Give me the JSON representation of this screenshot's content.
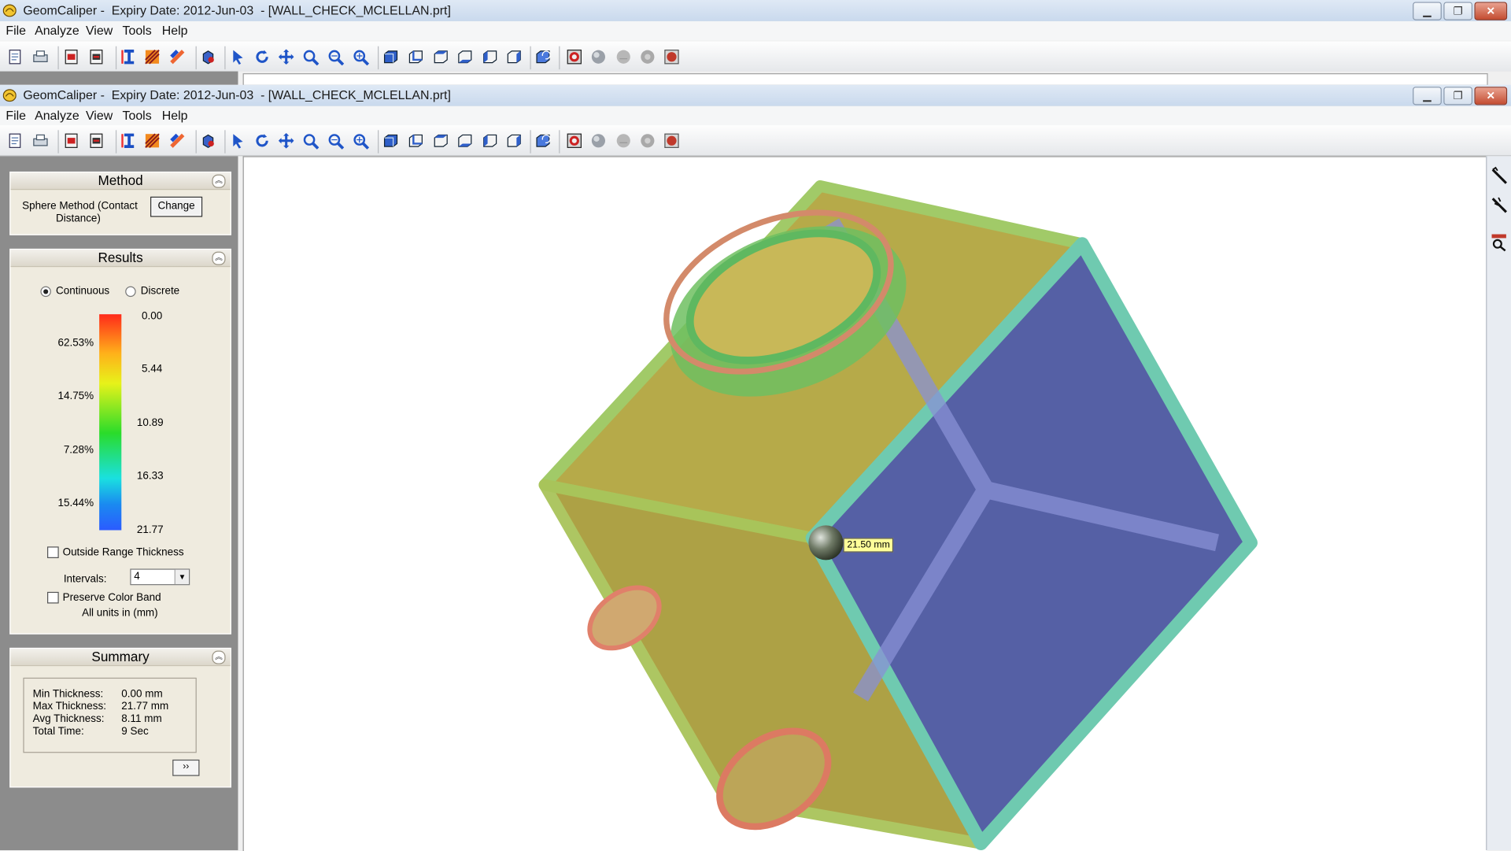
{
  "window": {
    "title": "GeomCaliper -  Expiry Date: 2012-Jun-03  - [WALL_CHECK_MCLELLAN.prt]",
    "buttons": {
      "minimize": "▁",
      "restore": "❐",
      "close": "✕"
    }
  },
  "menu": [
    "File",
    "Analyze",
    "View",
    "Tools",
    "Help"
  ],
  "toolbar": {
    "icons": [
      "new-icon",
      "print-icon",
      "import-icon",
      "export-icon",
      "wall-thickness-icon",
      "analysis-icon",
      "surface-icon",
      "part-icon",
      "select-arrow-icon",
      "rotate-icon",
      "pan-icon",
      "zoom-window-icon",
      "zoom-icon",
      "zoom-fit-icon",
      "view-front-icon",
      "view-back-icon",
      "view-top-icon",
      "view-bottom-icon",
      "view-left-icon",
      "view-right-icon",
      "view-iso-icon",
      "section-icon",
      "sphere-icon",
      "probe-icon",
      "sphere-gray-icon",
      "clear-icon"
    ]
  },
  "method": {
    "header": "Method",
    "text_line1": "Sphere Method (Contact",
    "text_line2": "Distance)",
    "change_label": "Change"
  },
  "results": {
    "header": "Results",
    "continuous_label": "Continuous",
    "discrete_label": "Discrete",
    "scale_values": [
      "0.00",
      "5.44",
      "10.89",
      "16.33",
      "21.77"
    ],
    "percentages": [
      "62.53%",
      "14.75%",
      "7.28%",
      "15.44%"
    ],
    "outside_range_label": "Outside Range Thickness",
    "intervals_label": "Intervals:",
    "intervals_value": "4",
    "preserve_label": "Preserve Color Band",
    "units_note": "All units in (mm)"
  },
  "summary": {
    "header": "Summary",
    "rows": [
      {
        "label": "Min Thickness:",
        "value": "0.00 mm"
      },
      {
        "label": "Max Thickness:",
        "value": "21.77 mm"
      },
      {
        "label": "Avg Thickness:",
        "value": "8.11 mm"
      },
      {
        "label": "Total Time:",
        "value": "9 Sec"
      }
    ],
    "more_label": "››"
  },
  "viewport": {
    "probe_label": "21.50 mm",
    "colors": {
      "yellow": "#b3a640",
      "blue": "#5560a5",
      "red": "#d8806a",
      "green": "#6bc86b"
    }
  },
  "right_tools": [
    "measure-icon",
    "measure-multi-icon",
    "probe-search-icon"
  ]
}
